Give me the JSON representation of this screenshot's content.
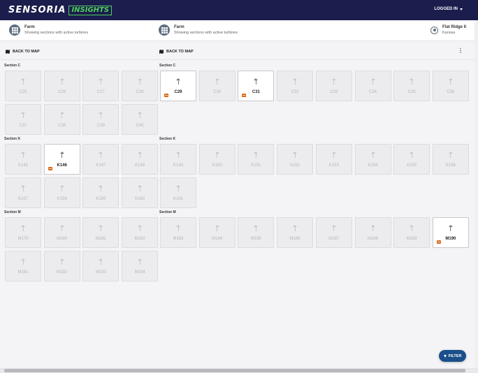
{
  "header": {
    "brand_main": "SENSORIA",
    "brand_insights": "INSIGHTS",
    "login_label": "LOGGED IN"
  },
  "info_left": {
    "title": "Farm",
    "subtitle": "Showing sections with active turbines"
  },
  "info_mid": {
    "title": "Farm",
    "subtitle": "Showing sections with active turbines"
  },
  "info_right": {
    "title": "Flat Ridge II",
    "subtitle": "Kansas"
  },
  "back_label": "BACK TO MAP",
  "more_label": "⋮",
  "filter_label": "FILTER",
  "left_panel": {
    "sections": [
      {
        "label": "Section C",
        "tiles": [
          {
            "id": "C25",
            "active": false
          },
          {
            "id": "C26",
            "active": false
          },
          {
            "id": "C27",
            "active": false
          },
          {
            "id": "C28",
            "active": false
          },
          {
            "id": "C37",
            "active": false
          },
          {
            "id": "C38",
            "active": false
          },
          {
            "id": "C39",
            "active": false
          },
          {
            "id": "C40",
            "active": false
          }
        ]
      },
      {
        "label": "Section K",
        "tiles": [
          {
            "id": "K145",
            "active": false
          },
          {
            "id": "K146",
            "active": true
          },
          {
            "id": "K147",
            "active": false
          },
          {
            "id": "K148",
            "active": false
          },
          {
            "id": "K157",
            "active": false
          },
          {
            "id": "K158",
            "active": false
          },
          {
            "id": "K159",
            "active": false
          },
          {
            "id": "K160",
            "active": false
          }
        ]
      },
      {
        "label": "Section M",
        "tiles": [
          {
            "id": "M179",
            "active": false
          },
          {
            "id": "M180",
            "active": false
          },
          {
            "id": "M181",
            "active": false
          },
          {
            "id": "M182",
            "active": false
          },
          {
            "id": "M191",
            "active": false
          },
          {
            "id": "M192",
            "active": false
          },
          {
            "id": "M193",
            "active": false
          },
          {
            "id": "M194",
            "active": false
          }
        ]
      }
    ]
  },
  "right_panel": {
    "sections": [
      {
        "label": "Section C",
        "tiles": [
          {
            "id": "C29",
            "active": true
          },
          {
            "id": "C30",
            "active": false
          },
          {
            "id": "C31",
            "active": true
          },
          {
            "id": "C32",
            "active": false
          },
          {
            "id": "C33",
            "active": false
          },
          {
            "id": "C34",
            "active": false
          },
          {
            "id": "C35",
            "active": false
          },
          {
            "id": "C36",
            "active": false
          }
        ]
      },
      {
        "label": "Section K",
        "tiles": [
          {
            "id": "K149",
            "active": false
          },
          {
            "id": "K150",
            "active": false
          },
          {
            "id": "K151",
            "active": false
          },
          {
            "id": "K152",
            "active": false
          },
          {
            "id": "K153",
            "active": false
          },
          {
            "id": "K154",
            "active": false
          },
          {
            "id": "K155",
            "active": false
          },
          {
            "id": "K156",
            "active": false
          },
          {
            "id": "K161",
            "active": false
          }
        ]
      },
      {
        "label": "Section M",
        "tiles": [
          {
            "id": "M183",
            "active": false
          },
          {
            "id": "M184",
            "active": false
          },
          {
            "id": "M185",
            "active": false
          },
          {
            "id": "M186",
            "active": false
          },
          {
            "id": "M187",
            "active": false
          },
          {
            "id": "M188",
            "active": false
          },
          {
            "id": "M189",
            "active": false
          },
          {
            "id": "M190",
            "active": true
          }
        ]
      }
    ]
  }
}
